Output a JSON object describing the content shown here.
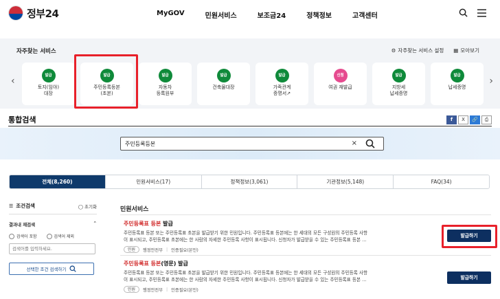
{
  "header": {
    "logo_text": "정부24",
    "nav": [
      "MyGOV",
      "민원서비스",
      "보조금24",
      "정책정보",
      "고객센터"
    ],
    "icons": [
      "search-icon",
      "menu-icon"
    ]
  },
  "frequent": {
    "title": "자주찾는 서비스",
    "settings_link": "자주찾는 서비스 설정",
    "view_all_link": "모아보기",
    "cards": [
      {
        "badge": "발급",
        "label": "토지(임야)\n대장"
      },
      {
        "badge": "발급",
        "label": "주민등록등본\n(초본)"
      },
      {
        "badge": "발급",
        "label": "자동차\n등록원부"
      },
      {
        "badge": "발급",
        "label": "건축물대장"
      },
      {
        "badge": "발급",
        "label": "가족관계\n증명서↗"
      },
      {
        "badge": "신청",
        "label": "여권 재발급"
      },
      {
        "badge": "발급",
        "label": "지방세\n납세증명"
      },
      {
        "badge": "발급",
        "label": "납세증명"
      }
    ]
  },
  "search": {
    "title": "통합검색",
    "query": "주민등록등본",
    "share_labels": [
      "f",
      "X",
      "🔗",
      "⎙"
    ]
  },
  "tabs": [
    {
      "label": "전체(8,260)",
      "active": true
    },
    {
      "label": "민원서비스(17)",
      "active": false
    },
    {
      "label": "정책정보(3,061)",
      "active": false
    },
    {
      "label": "기관정보(5,148)",
      "active": false
    },
    {
      "label": "FAQ(34)",
      "active": false
    }
  ],
  "filter": {
    "title": "조건검색",
    "reset": "초기화",
    "within_title": "결과내 재검색",
    "radio_include": "검색어 포함",
    "radio_exclude": "검색어 제외",
    "input_placeholder": "검색어를 입력하세요.",
    "button_label": "선택한 조건 검색하기"
  },
  "results": {
    "section_title": "민원서비스",
    "items": [
      {
        "title_red": "주민등록표 등본",
        "title_rest": " 발급",
        "desc1": "주민등록표 등본 또는 주민등록표 초본을 발급받기 위한 민원입니다. 주민등록표 등본에는 한 세대의 모든 구성원의 주민등록 사항",
        "desc2": "이 표시되고, 주민등록표 초본에는 한 사람의 자세한 주민등록 사항이 표시됩니다. 신청자가 발급받을 수 있는 주민등록표 등본 ...",
        "tag": "민원",
        "agency": "행정안전부",
        "auth": "인증필요(본인)",
        "button": "발급하기"
      },
      {
        "title_red": "주민등록표 등본",
        "title_rest": "(영문) 발급",
        "desc1": "주민등록표 등본 또는 주민등록표 초본을 발급받기 위한 민원입니다. 주민등록표 등본에는 한 세대의 모든 구성원의 주민등록 사항",
        "desc2": "이 표시되고, 주민등록표 초본에는 한 사람의 자세한 주민등록 사항이 표시됩니다. 신청자가 발급받을 수 있는 주민등록표 등본 ...",
        "tag": "민원",
        "agency": "행정안전부",
        "auth": "인증필요(본인)",
        "button": "발급하기"
      }
    ]
  },
  "colors": {
    "navy": "#0f3a6b",
    "button": "#0d2f60",
    "highlight": "#e8202a",
    "badge_green": "#0f8a3a",
    "badge_pink": "#e64b8f"
  }
}
